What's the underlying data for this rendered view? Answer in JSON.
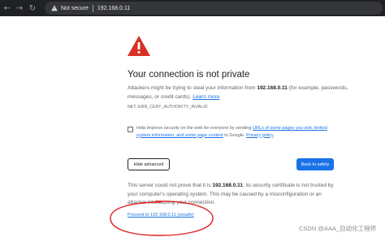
{
  "browser": {
    "security_label": "Not secure",
    "url": "192.168.0.11",
    "icons": {
      "back": "arrow-left-icon",
      "forward": "arrow-right-icon",
      "reload": "reload-icon",
      "security": "warning-triangle-icon"
    }
  },
  "interstitial": {
    "icon": "red-warning-triangle-icon",
    "title": "Your connection is not private",
    "intro_prefix": "Attackers might be trying to steal your information from ",
    "intro_host": "192.168.0.11",
    "intro_suffix": " (for example, passwords, messages, or credit cards). ",
    "learn_more": "Learn more",
    "error_code": "NET::ERR_CERT_AUTHORITY_INVALID",
    "checkbox": {
      "checked": false,
      "text_prefix": "Help improve security on the web for everyone by sending ",
      "link1": "URLs of some pages you visit, limited system information, and some page content",
      "text_mid": " to Google. ",
      "link2": "Privacy policy"
    },
    "hide_advanced_label": "Hide advanced",
    "back_to_safety_label": "Back to safety",
    "advanced_prefix": "This server could not prove that it is ",
    "advanced_host": "192.168.0.11",
    "advanced_suffix": "; its security certificate is not trusted by your computer's operating system. This may be caused by a misconfiguration or an attacker intercepting your connection.",
    "proceed_link": "Proceed to 192.168.0.11 (unsafe)"
  },
  "colors": {
    "accent": "#1a73e8",
    "warning_red": "#d93025",
    "annotation_red": "#e02020"
  },
  "watermark": "CSDN @AAA_自动化工程师"
}
